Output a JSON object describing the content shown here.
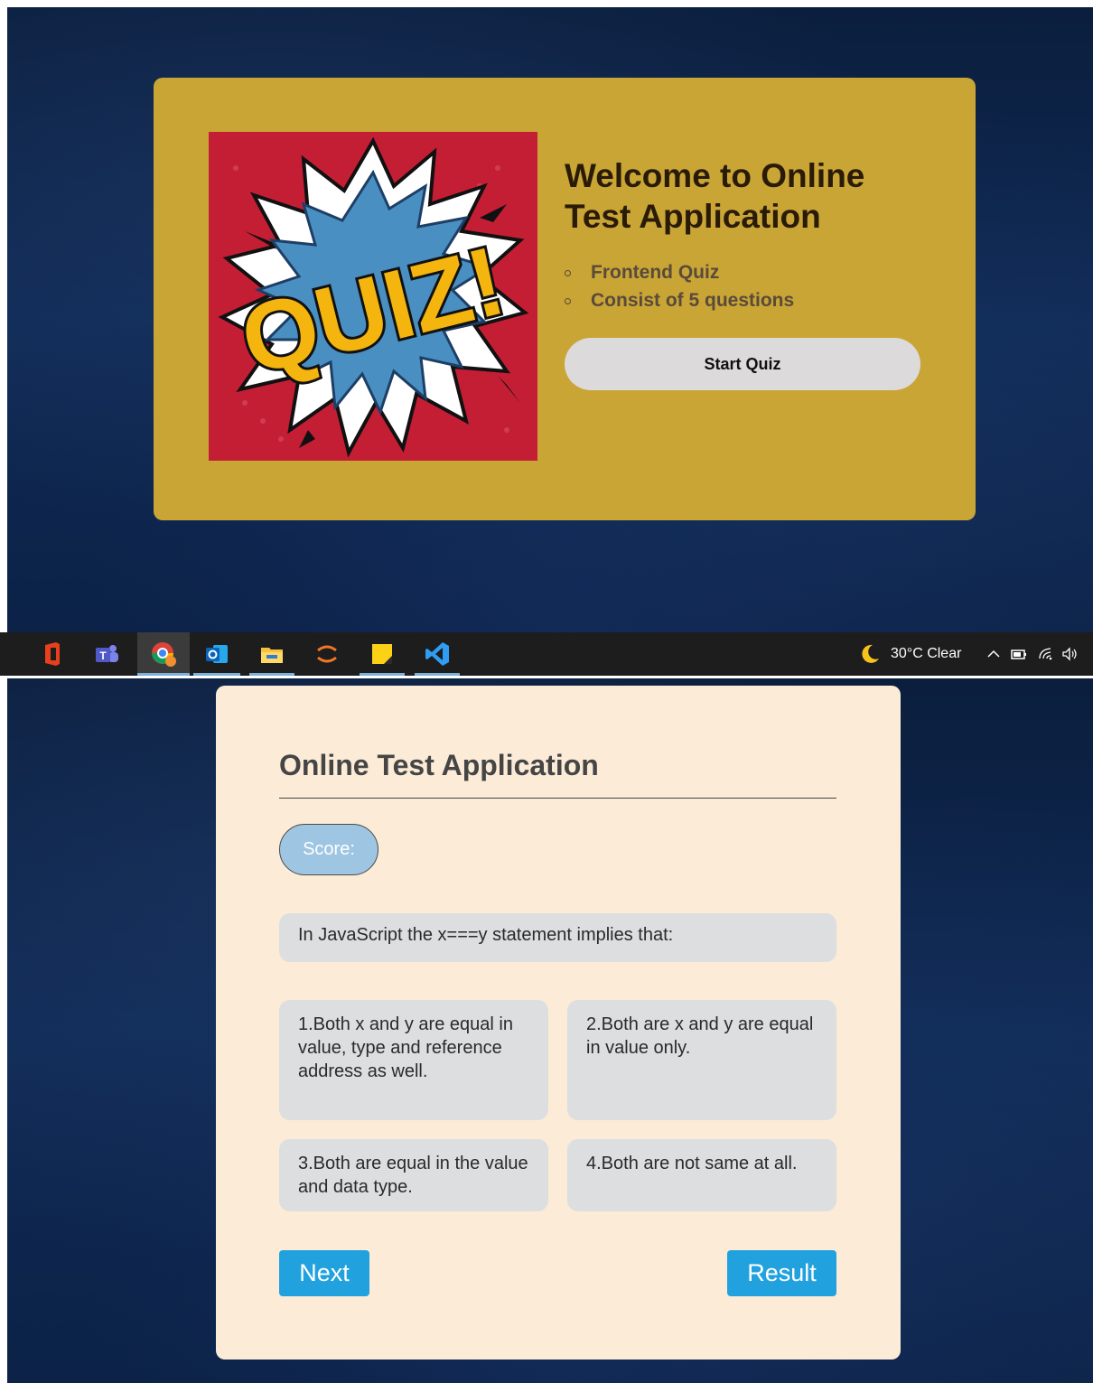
{
  "welcome": {
    "logo_text": "QUIZ!",
    "title": "Welcome to Online Test Application",
    "info": [
      "Frontend Quiz",
      "Consist of 5 questions"
    ],
    "start_label": "Start Quiz"
  },
  "taskbar": {
    "icons": [
      "office-icon",
      "teams-icon",
      "chrome-icon",
      "outlook-icon",
      "file-explorer-icon",
      "jupyter-icon",
      "sticky-notes-icon",
      "vscode-icon"
    ],
    "weather": "30°C  Clear",
    "tray": [
      "chevron-up-icon",
      "battery-icon",
      "wifi-icon",
      "volume-icon"
    ]
  },
  "quiz": {
    "title": "Online Test Application",
    "score_label": "Score:",
    "question": "In JavaScript the x===y statement implies that:",
    "options": [
      "1.Both x and y are equal in value, type and reference address as well.",
      "2.Both are x and y are equal in value only.",
      "3.Both are equal in the value and data type.",
      "4.Both are not same at all."
    ],
    "next_label": "Next",
    "result_label": "Result"
  },
  "colors": {
    "welcome_card": "#c8a535",
    "quiz_card": "#fbebd7",
    "button_blue": "#21a2de",
    "score_pill": "#9ec6e2",
    "background": "#0f2a55"
  }
}
